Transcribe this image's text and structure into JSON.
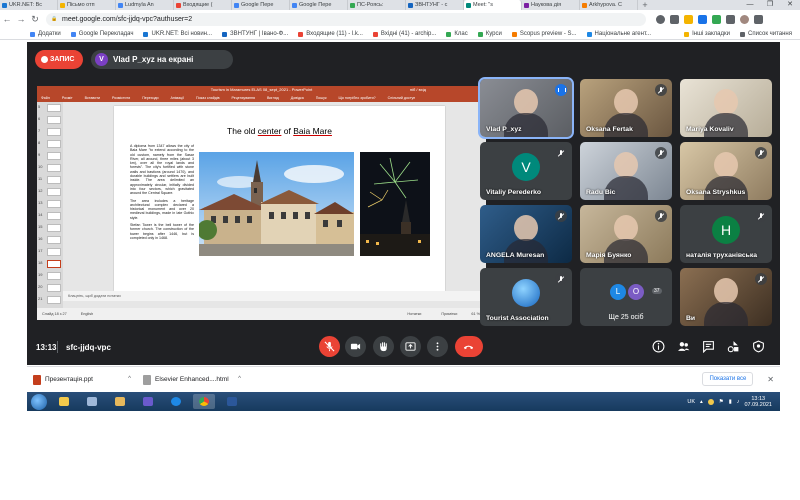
{
  "browser": {
    "tabs": [
      {
        "label": "UKR.NET: Вс",
        "favicon_color": "#1976d2"
      },
      {
        "label": "Пісьмо отп",
        "favicon_color": "#f4b400"
      },
      {
        "label": "Ludmyla An",
        "favicon_color": "#4285f4"
      },
      {
        "label": "Входящие (",
        "favicon_color": "#ea4335"
      },
      {
        "label": "Google Пере",
        "favicon_color": "#4285f4"
      },
      {
        "label": "Google Пере",
        "favicon_color": "#4285f4"
      },
      {
        "label": "ПС-Роясь:",
        "favicon_color": "#34a853"
      },
      {
        "label": "ЗВНТУНГ - с",
        "favicon_color": "#1565c0"
      },
      {
        "label": "Meet: \"s",
        "favicon_color": "#00897b",
        "active": true
      },
      {
        "label": "Наукова дія",
        "favicon_color": "#7b1fa2"
      },
      {
        "label": "Arkhypova. C",
        "favicon_color": "#f57c00"
      }
    ],
    "url": "meet.google.com/sfc-jjdq-vpc?authuser=2",
    "bookmarks": [
      {
        "label": "Додатки",
        "color": "#4285f4"
      },
      {
        "label": "Google Перекладач",
        "color": "#4285f4"
      },
      {
        "label": "UKR.NET: Всі новин...",
        "color": "#1976d2"
      },
      {
        "label": "ЗВНТУНГ | Івано-Ф...",
        "color": "#1565c0"
      },
      {
        "label": "Входящие (11) - l.k...",
        "color": "#ea4335"
      },
      {
        "label": "Вхідні (41) - archip...",
        "color": "#ea4335"
      },
      {
        "label": "Клас",
        "color": "#34a853"
      },
      {
        "label": "Курси",
        "color": "#34a853"
      },
      {
        "label": "Scopus preview - S...",
        "color": "#f57c00"
      },
      {
        "label": "Національне агент...",
        "color": "#1e88e5"
      }
    ],
    "bookmarks_right": [
      {
        "label": "Інші закладки",
        "color": "#f4b400"
      },
      {
        "label": "Список читання",
        "color": "#5f6368"
      }
    ]
  },
  "meet": {
    "recording_label": "ЗАПИС",
    "presenter_initial": "V",
    "presenting_label": "Vlad P_xyz на екрані",
    "meeting_time": "13:13",
    "meeting_code": "sfc-jjdq-vpc",
    "participant_count": "37",
    "participants": [
      {
        "name": "Vlad P_xyz",
        "speaking": true,
        "active": true
      },
      {
        "name": "Oksana Fertak",
        "muted": true
      },
      {
        "name": "Mariya Kovaliv",
        "muted": false
      },
      {
        "name": "Vitaliy Perederko",
        "muted": true,
        "initial": "V",
        "avatar_color": "#00897b"
      },
      {
        "name": "Radu Bic",
        "muted": true
      },
      {
        "name": "Oksana Stryshkus",
        "muted": true
      },
      {
        "name": "ANGELA Muresan",
        "muted": true
      },
      {
        "name": "Марія Буянко",
        "muted": true
      },
      {
        "name": "наталія труханівська",
        "muted": true,
        "initial": "Н",
        "avatar_color": "#0b8043"
      },
      {
        "name": "Tourist Association",
        "muted": true
      },
      {
        "name": "Ще 25 осіб",
        "mini_initials": [
          "L",
          "O"
        ]
      },
      {
        "name": "Ви",
        "muted": true
      }
    ]
  },
  "ppt": {
    "window_title": "Tourism in Maramures ELAS 08_sept_2021  -  PowerPoint",
    "sign_in": "ніб / вхід",
    "ribbon": [
      "Файл",
      "Розміт",
      "Вставити",
      "Розмістити",
      "Переходи",
      "Анімації",
      "Показ слайдів",
      "Рецензування",
      "Вигляд",
      "Довідка",
      "Пошук",
      "Що потрібно зробити?",
      "Спільний доступ"
    ],
    "thumb_numbers": [
      "5",
      "6",
      "7",
      "8",
      "9",
      "10",
      "11",
      "12",
      "13",
      "14",
      "15",
      "16",
      "17",
      "18",
      "19",
      "20",
      "21"
    ],
    "selected_slide": "18",
    "slide_title_plain": "The old ",
    "slide_title_under1": "center",
    "slide_title_mid": " of ",
    "slide_title_under2": "Baia Mare",
    "slide_para1": "A diploma from 1347 allows the city of Baia Mare \"to extend according to the old custom, namely from the Sasar River, all around, three miles (about 3 km), over all the royal lands and forests\". The city's fortified with stone walls and bastions (around 1470), and durable buildings and settlers are built inside. The area delimited an approximately circular, initially divided into four sectors, which gravitated around the Central Square.",
    "slide_para2": "The area includes a heritage architectural complex declared a historical monument and over 20 medieval buildings, made in late Gothic style.",
    "slide_para3": "Stefan Tower is the bell tower of the former church. The construction of the tower begins after 1446, but is completed only in 1468.",
    "notes": "Клацніть, щоб додати нотатки",
    "status_left": "Слайд 18 з 27",
    "status_lang": "English",
    "status_notes": "Нотатки",
    "status_comments": "Примітки",
    "status_zoom": "61 %"
  },
  "downloads": [
    {
      "label": "Презентація.ppt",
      "color": "#c43e1c"
    },
    {
      "label": "Elsevier Enhanced....html",
      "color": "#9e9e9e"
    }
  ],
  "show_all_label": "Показати все",
  "taskbar": {
    "lang": "UK",
    "time": "13:13",
    "date": "07.09.2021"
  }
}
